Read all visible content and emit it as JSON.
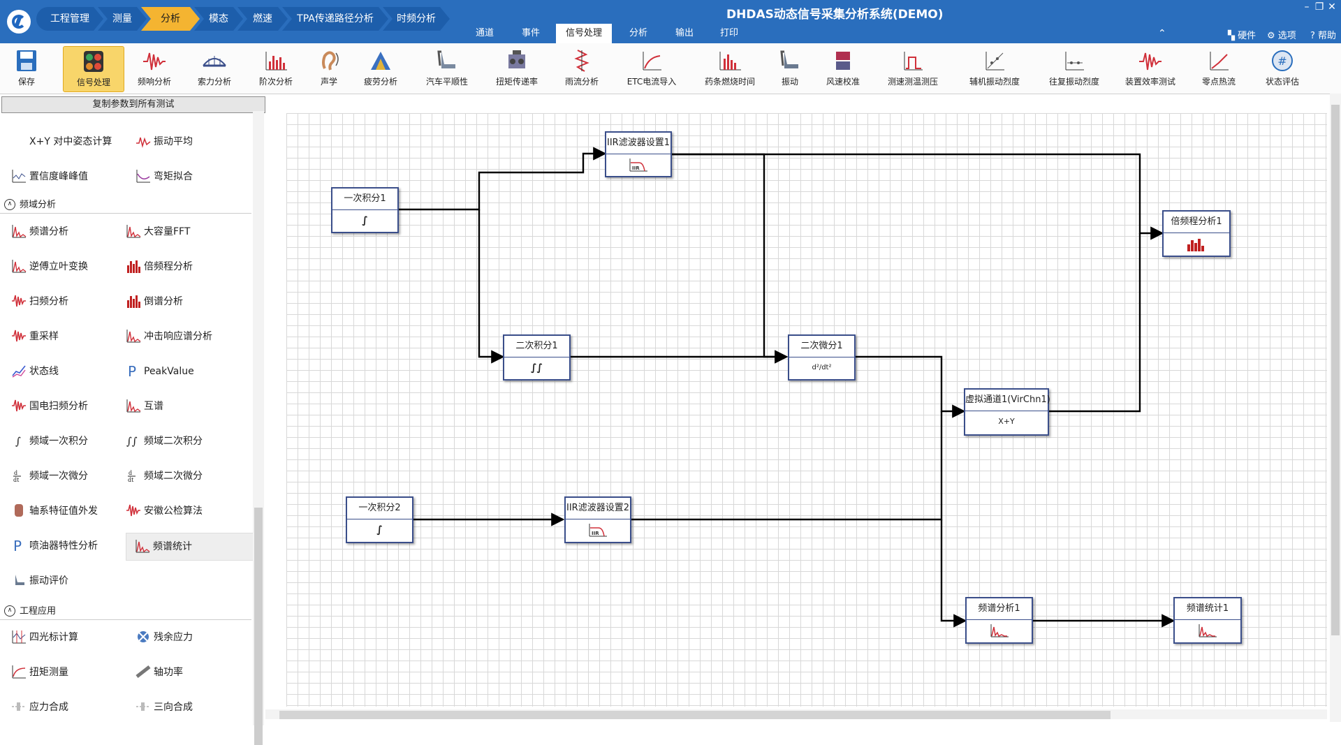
{
  "app": {
    "title": "DHDAS动态信号采集分析系统(DEMO)"
  },
  "breadcrumbs": [
    "工程管理",
    "测量",
    "分析",
    "模态",
    "燃速",
    "TPA传递路径分析",
    "时频分析"
  ],
  "menu_tabs": [
    "通道",
    "事件",
    "信号处理",
    "分析",
    "输出",
    "打印"
  ],
  "top_right": {
    "hardware": "硬件",
    "options": "选项",
    "help": "帮助"
  },
  "window_controls": {
    "minimize": "–",
    "restore": "❐",
    "close": "✕"
  },
  "ribbon": [
    "保存",
    "信号处理",
    "频响分析",
    "索力分析",
    "阶次分析",
    "声学",
    "疲劳分析",
    "汽车平顺性",
    "扭矩传递率",
    "雨流分析",
    "ETC电流导入",
    "药条燃烧时间",
    "振动",
    "风速校准",
    "测速测温测压",
    "辅机振动烈度",
    "往复振动烈度",
    "装置效率测试",
    "零点热流",
    "状态评估"
  ],
  "palette": {
    "copy_button": "复制参数到所有测试",
    "top_items": [
      "X+Y 对中姿态计算",
      "振动平均",
      "置信度峰峰值",
      "弯矩拟合"
    ],
    "freq_section": "频域分析",
    "freq_items": [
      "频谱分析",
      "大容量FFT",
      "逆傅立叶变换",
      "倍频程分析",
      "扫频分析",
      "倒谱分析",
      "重采样",
      "冲击响应谱分析",
      "状态线",
      "PeakValue",
      "国电扫频分析",
      "互谱",
      "频域一次积分",
      "频域二次积分",
      "频域一次微分",
      "频域二次微分",
      "轴系特征值外发",
      "安徽公检算法",
      "喷油器特性分析",
      "频谱统计",
      "振动评价"
    ],
    "eng_section": "工程应用",
    "eng_items": [
      "四光标计算",
      "残余应力",
      "扭矩测量",
      "轴功率",
      "应力合成",
      "三向合成"
    ]
  },
  "nodes": [
    {
      "title": "一次积分1",
      "body": "∫"
    },
    {
      "title": "IIR滤波器设置1",
      "body": "IIR"
    },
    {
      "title": "二次积分1",
      "body": "∫∫"
    },
    {
      "title": "二次微分1",
      "body": "d²/dt²"
    },
    {
      "title": "倍频程分析1",
      "body": ""
    },
    {
      "title": "虚拟通道1(VirChn1)",
      "body": "X+Y"
    },
    {
      "title": "一次积分2",
      "body": "∫"
    },
    {
      "title": "IIR滤波器设置2",
      "body": "IIR"
    },
    {
      "title": "频谱分析1",
      "body": ""
    },
    {
      "title": "频谱统计1",
      "body": ""
    }
  ],
  "colors": {
    "titlebar": "#2a6ebd",
    "breadcrumb_active": "#f4b431",
    "ribbon_active": "#f8d56a",
    "node_border": "#3a4e8a"
  }
}
